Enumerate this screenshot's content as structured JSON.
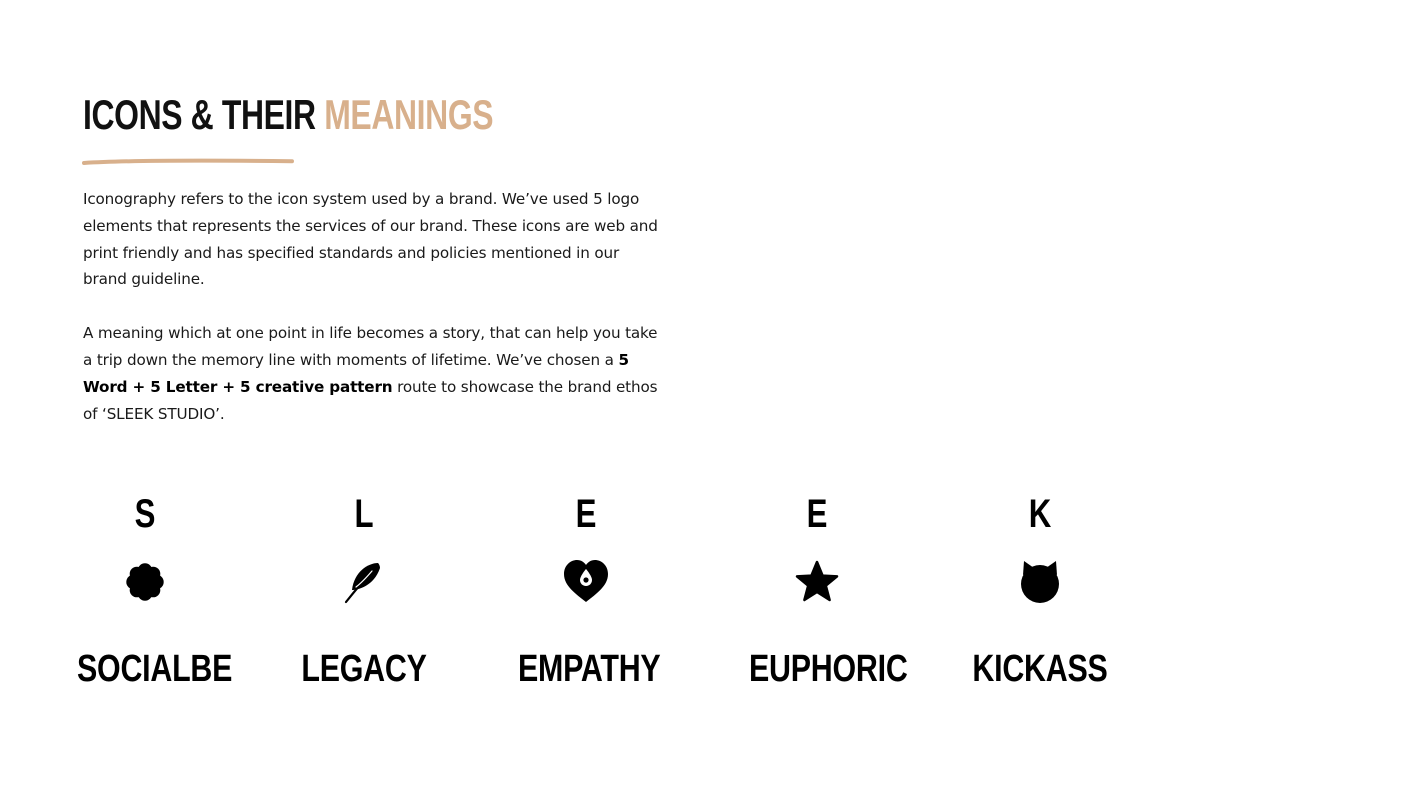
{
  "header": {
    "title_main": "ICONS & THEIR",
    "title_accent": "MEANINGS",
    "accent_color": "#d8b08c"
  },
  "intro": {
    "paragraph_1": "Iconography refers to the icon system used by a brand. We’ve used 5 logo elements that represents  the services of our brand. These icons are web and print friendly and has specified standards and policies mentioned in our brand guideline.",
    "paragraph_2_start": "A meaning which at one point in life becomes a story, that can help you take a trip down the memory line with moments of lifetime. We’ve chosen a ",
    "paragraph_2_bold": "5 Word + 5 Letter + 5 creative pattern",
    "paragraph_2_end": " route to showcase the brand ethos of ‘SLEEK STUDIO’."
  },
  "icons": [
    {
      "letter": "S",
      "word": "SOCIALBE",
      "icon": "flower-icon"
    },
    {
      "letter": "L",
      "word": "LEGACY",
      "icon": "feather-icon"
    },
    {
      "letter": "E",
      "word": "EMPATHY",
      "icon": "heart-drop-icon"
    },
    {
      "letter": "E",
      "word": "EUPHORIC",
      "icon": "star-icon"
    },
    {
      "letter": "K",
      "word": "KICKASS",
      "icon": "devil-horns-icon"
    }
  ]
}
